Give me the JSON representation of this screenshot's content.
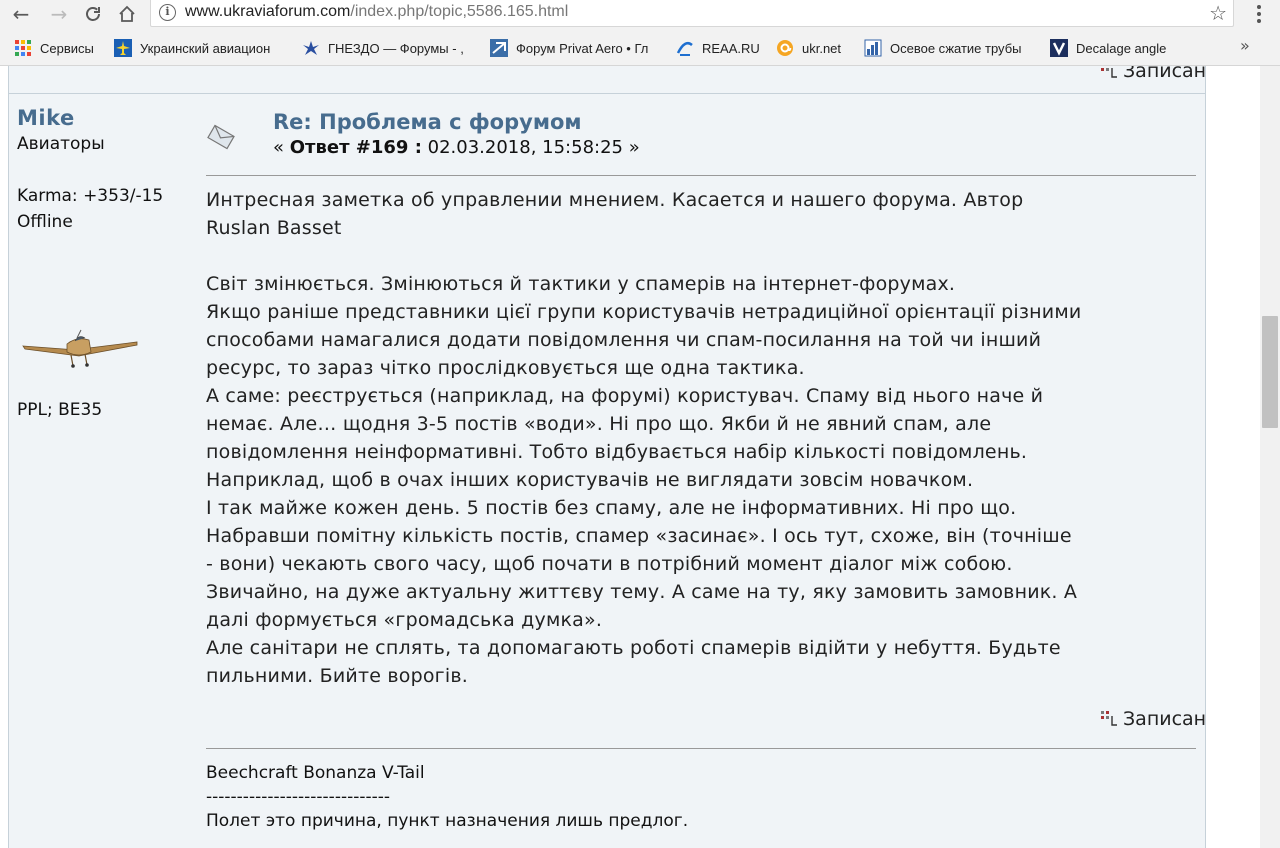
{
  "browser": {
    "url_host": "www.ukraviaforum.com",
    "url_path": "/index.php/topic,5586.165.html",
    "bookmarks": [
      {
        "label": "Сервисы",
        "icon": "apps-grid-icon"
      },
      {
        "label": "Украинский авиацион",
        "icon": "airplane-icon"
      },
      {
        "label": "ГНЕЗДО — Форумы - ,",
        "icon": "bird-icon"
      },
      {
        "label": "Форум Privat Aero • Гл",
        "icon": "privat-aero-icon"
      },
      {
        "label": "REAA.RU",
        "icon": "reaa-icon"
      },
      {
        "label": "ukr.net",
        "icon": "at-sign-icon"
      },
      {
        "label": "Осевое сжатие трубы",
        "icon": "chart-icon"
      },
      {
        "label": "Decalage angle",
        "icon": "v-logo-icon"
      }
    ],
    "bookmarks_more": "»"
  },
  "post": {
    "prev_saved_label": "Записан",
    "poster": {
      "name": "Mike",
      "group": "Авиаторы",
      "karma": "Karma: +353/-15",
      "status": "Offline",
      "signature_line": "PPL; BE35"
    },
    "subject": "Re: Проблема с форумом",
    "meta_prefix": "«",
    "reply_label": "Ответ #169 :",
    "date": "02.03.2018, 15:58:25",
    "meta_suffix": "»",
    "body": [
      "Интресная заметка об управлении мнением. Касается и нашего форума. Автор\nRuslan Basset",
      "Світ змінюється. Змінюються й тактики у спамерів на інтернет-форумах.\nЯкщо раніше представники цієї групи користувачів нетрадиційної орієнтації різними\nспособами намагалися додати повідомлення чи спам-посилання на той чи інший\nресурс, то зараз чітко прослідковується ще одна тактика.\nА саме: реєструється (наприклад, на форумі) користувач. Спаму від нього наче й\nнемає. Але… щодня 3-5 постів «води». Ні про що. Якби й не явний спам, але\nповідомлення неінформативні. Тобто відбувається набір кількості повідомлень.\nНаприклад, щоб в очах інших користувачів не виглядати зовсім новачком.\nІ так майже кожен день. 5 постів без спаму, але не інформативних. Ні про що.\nНабравши помітну кількість постів, спамер «засинає». І ось тут, схоже, він (точніше\n- вони) чекають свого часу, щоб почати в потрібний момент діалог між собою.\nЗвичайно, на дуже актуальну життєву тему. А саме на ту, яку замовить замовник. А\nдалі формується «громадська думка».\nАле санітари не сплять, та допомагають роботі спамерів відійти у небуття. Будьте\nпильними. Бийте ворогів."
    ],
    "saved_label": "Записан",
    "signature": [
      "Beechcraft Bonanza V-Tail",
      "------------------------------",
      "Полет это причина, пункт назначения лишь предлог."
    ]
  }
}
